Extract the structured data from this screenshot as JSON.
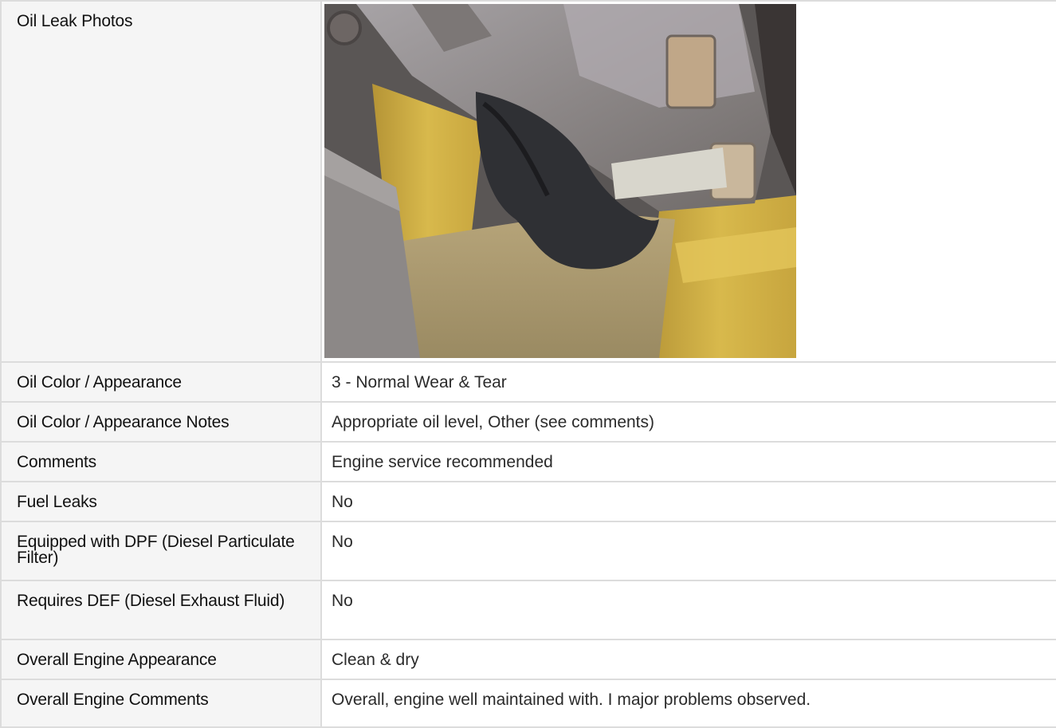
{
  "rows": [
    {
      "label": "Oil Leak Photos",
      "value": ""
    },
    {
      "label": "Oil Color / Appearance",
      "value": "3 - Normal Wear & Tear"
    },
    {
      "label": "Oil Color / Appearance Notes",
      "value": "Appropriate oil level, Other (see comments)"
    },
    {
      "label": "Comments",
      "value": "Engine service recommended"
    },
    {
      "label": "Fuel Leaks",
      "value": "No"
    },
    {
      "label": "Equipped with DPF (Diesel Particulate Filter)",
      "value": "No"
    },
    {
      "label": "Requires DEF (Diesel Exhaust Fluid)",
      "value": "No"
    },
    {
      "label": "Overall Engine Appearance",
      "value": "Clean & dry"
    },
    {
      "label": "Overall Engine Comments",
      "value": "Overall, engine well maintained with. I major problems observed."
    }
  ],
  "photo": {
    "icon": "oil-leak-photo",
    "colors": {
      "yellow": "#c9a640",
      "metal": "#8e8a88",
      "dark": "#3b3b3d",
      "dust": "#a89970"
    }
  }
}
